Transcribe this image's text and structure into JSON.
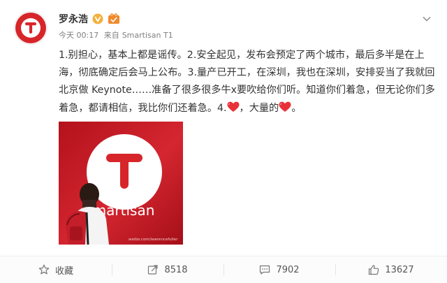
{
  "post": {
    "author_name": "罗永浩",
    "time": "今天 00:17",
    "source_prefix": "来自",
    "source": "Smartisan T1",
    "text_segments": [
      "1.别担心，基本上都是谣传。2.安全起见，发布会预定了两个城市，最后多半是在上海，彻底确定后会马上公布。3.量产已开工，在深圳，我也在深圳，安排妥当了我就回北京做 Keynote……准备了很多很多牛x要吹给你们听。知道你们着急，但无论你们多着急，都请相信，我比你们还着急。4.",
      "，大量的",
      "。"
    ]
  },
  "photo": {
    "logo_letter": "T",
    "brand_text": "Smartisan",
    "watermark": "weibo.com/lawrencefuller"
  },
  "actions": {
    "favorite_label": "收藏",
    "repost_count": "8518",
    "comment_count": "7902",
    "like_count": "13627"
  },
  "colors": {
    "brand_red": "#d7262a",
    "heart": "#e8323a",
    "vip_gold": "#f4b13c"
  },
  "icons": [
    "t-logo-icon",
    "verified-v-icon",
    "level-badge-icon",
    "chevron-down-icon",
    "heart-icon",
    "star-icon",
    "repost-icon",
    "comment-icon",
    "thumbs-up-icon"
  ]
}
